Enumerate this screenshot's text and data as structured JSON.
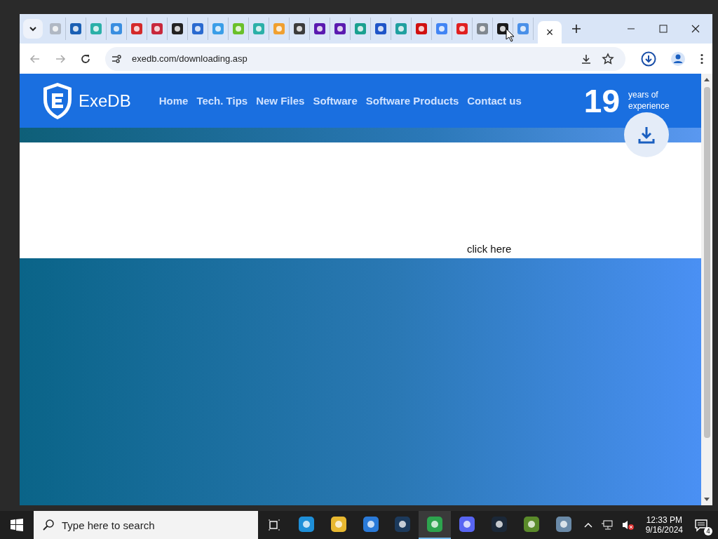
{
  "browser": {
    "tabs": [
      {
        "selected": false,
        "color": "#b0b8c4"
      },
      {
        "selected": false,
        "color": "#1a5fb4"
      },
      {
        "selected": false,
        "color": "#2bb0a8"
      },
      {
        "selected": false,
        "color": "#3a8ee0"
      },
      {
        "selected": false,
        "color": "#d42a2a"
      },
      {
        "selected": false,
        "color": "#c8283c"
      },
      {
        "selected": false,
        "color": "#222222"
      },
      {
        "selected": false,
        "color": "#2a6ad0"
      },
      {
        "selected": false,
        "color": "#3a9ee8"
      },
      {
        "selected": false,
        "color": "#6ac02a"
      },
      {
        "selected": false,
        "color": "#2bb0a8"
      },
      {
        "selected": false,
        "color": "#f0a030"
      },
      {
        "selected": false,
        "color": "#3c3c3c"
      },
      {
        "selected": false,
        "color": "#5a1ab0"
      },
      {
        "selected": false,
        "color": "#5a1ab0"
      },
      {
        "selected": false,
        "color": "#1aa090"
      },
      {
        "selected": false,
        "color": "#1f55c8"
      },
      {
        "selected": false,
        "color": "#20a0a0"
      },
      {
        "selected": false,
        "color": "#d01010"
      },
      {
        "selected": false,
        "color": "#4285f4"
      },
      {
        "selected": false,
        "color": "#e02020"
      },
      {
        "selected": false,
        "color": "#808890"
      },
      {
        "selected": false,
        "color": "#1a1a1a"
      },
      {
        "selected": false,
        "color": "#4a90e8"
      },
      {
        "selected": true
      }
    ],
    "tab_close": "×",
    "url": "exedb.com/downloading.asp"
  },
  "site": {
    "logo": "ExeDB",
    "nav": [
      "Home",
      "Tech. Tips",
      "New Files",
      "Software",
      "Software Products",
      "Contact us"
    ],
    "years": "19",
    "years_caption": "years of experience",
    "link": "click here"
  },
  "taskbar": {
    "search_placeholder": "Type here to search",
    "apps": [
      {
        "selected": false,
        "color": "#1e8fd8"
      },
      {
        "selected": false,
        "color": "#e8b830"
      },
      {
        "selected": false,
        "color": "#2a7ad8"
      },
      {
        "selected": false,
        "color": "#1c3a5c"
      },
      {
        "selected": true,
        "color": "#2da44e"
      },
      {
        "selected": false,
        "color": "#5865f2"
      },
      {
        "selected": false,
        "color": "#1b2838"
      },
      {
        "selected": false,
        "color": "#5a8a2a"
      },
      {
        "selected": false,
        "color": "#6a8aa8"
      }
    ],
    "time": "12:33 PM",
    "date": "9/16/2024",
    "notifications": "4"
  }
}
